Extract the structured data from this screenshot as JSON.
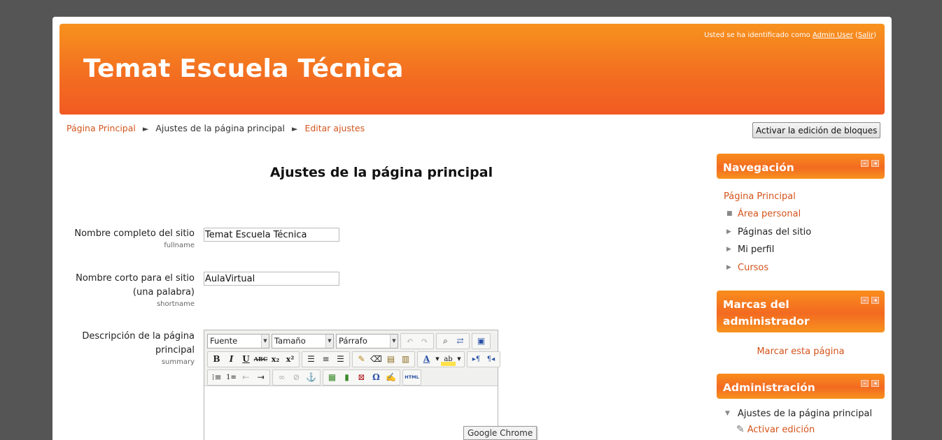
{
  "header": {
    "login_prefix": "Usted se ha identificado como",
    "user_name": "Admin User",
    "logout_label": "Salir",
    "site_title": "Temat Escuela Técnica"
  },
  "breadcrumb": {
    "home": "Página Principal",
    "current": "Ajustes de la página principal",
    "last": "Editar ajustes",
    "separator": "►"
  },
  "edit_blocks_button": "Activar la edición de bloques",
  "main": {
    "heading": "Ajustes de la página principal",
    "fields": [
      {
        "label": "Nombre completo del sitio",
        "sub": "fullname",
        "value": "Temat Escuela Técnica"
      },
      {
        "label_line1": "Nombre corto para el sitio",
        "label_line2": "(una palabra)",
        "sub": "shortname",
        "value": "AulaVirtual"
      },
      {
        "label_line1": "Descripción de la página",
        "label_line2": "principal",
        "sub": "summary"
      }
    ],
    "editor": {
      "font_select": "Fuente",
      "size_select": "Tamaño",
      "format_select": "Párrafo",
      "html_button": "HTML"
    }
  },
  "sidebar": {
    "navigation": {
      "title": "Navegación",
      "home": "Página Principal",
      "items": [
        {
          "label": "Área personal"
        },
        {
          "label": "Páginas del sitio"
        },
        {
          "label": "Mi perfil"
        },
        {
          "label": "Cursos"
        }
      ]
    },
    "bookmarks": {
      "title_line1": "Marcas del",
      "title_line2": "administrador",
      "link": "Marcar esta página"
    },
    "admin": {
      "title": "Administración",
      "item": "Ajustes de la página principal",
      "sub_item": "Activar edición"
    }
  },
  "tooltip": "Google Chrome",
  "colors": {
    "accent": "#f36f21",
    "link": "#d4541c",
    "background": "#555555"
  }
}
